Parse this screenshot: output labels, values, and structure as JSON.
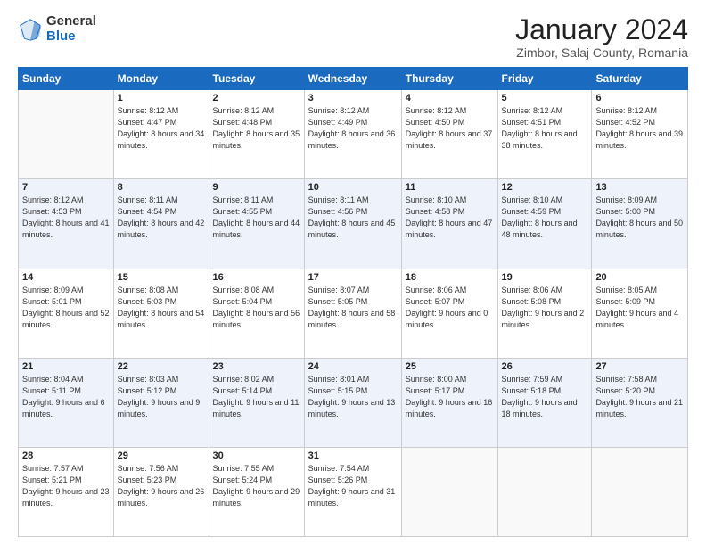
{
  "logo": {
    "general": "General",
    "blue": "Blue"
  },
  "title": "January 2024",
  "location": "Zimbor, Salaj County, Romania",
  "weekdays": [
    "Sunday",
    "Monday",
    "Tuesday",
    "Wednesday",
    "Thursday",
    "Friday",
    "Saturday"
  ],
  "weeks": [
    [
      {
        "day": "",
        "sunrise": "",
        "sunset": "",
        "daylight": ""
      },
      {
        "day": "1",
        "sunrise": "Sunrise: 8:12 AM",
        "sunset": "Sunset: 4:47 PM",
        "daylight": "Daylight: 8 hours and 34 minutes."
      },
      {
        "day": "2",
        "sunrise": "Sunrise: 8:12 AM",
        "sunset": "Sunset: 4:48 PM",
        "daylight": "Daylight: 8 hours and 35 minutes."
      },
      {
        "day": "3",
        "sunrise": "Sunrise: 8:12 AM",
        "sunset": "Sunset: 4:49 PM",
        "daylight": "Daylight: 8 hours and 36 minutes."
      },
      {
        "day": "4",
        "sunrise": "Sunrise: 8:12 AM",
        "sunset": "Sunset: 4:50 PM",
        "daylight": "Daylight: 8 hours and 37 minutes."
      },
      {
        "day": "5",
        "sunrise": "Sunrise: 8:12 AM",
        "sunset": "Sunset: 4:51 PM",
        "daylight": "Daylight: 8 hours and 38 minutes."
      },
      {
        "day": "6",
        "sunrise": "Sunrise: 8:12 AM",
        "sunset": "Sunset: 4:52 PM",
        "daylight": "Daylight: 8 hours and 39 minutes."
      }
    ],
    [
      {
        "day": "7",
        "sunrise": "Sunrise: 8:12 AM",
        "sunset": "Sunset: 4:53 PM",
        "daylight": "Daylight: 8 hours and 41 minutes."
      },
      {
        "day": "8",
        "sunrise": "Sunrise: 8:11 AM",
        "sunset": "Sunset: 4:54 PM",
        "daylight": "Daylight: 8 hours and 42 minutes."
      },
      {
        "day": "9",
        "sunrise": "Sunrise: 8:11 AM",
        "sunset": "Sunset: 4:55 PM",
        "daylight": "Daylight: 8 hours and 44 minutes."
      },
      {
        "day": "10",
        "sunrise": "Sunrise: 8:11 AM",
        "sunset": "Sunset: 4:56 PM",
        "daylight": "Daylight: 8 hours and 45 minutes."
      },
      {
        "day": "11",
        "sunrise": "Sunrise: 8:10 AM",
        "sunset": "Sunset: 4:58 PM",
        "daylight": "Daylight: 8 hours and 47 minutes."
      },
      {
        "day": "12",
        "sunrise": "Sunrise: 8:10 AM",
        "sunset": "Sunset: 4:59 PM",
        "daylight": "Daylight: 8 hours and 48 minutes."
      },
      {
        "day": "13",
        "sunrise": "Sunrise: 8:09 AM",
        "sunset": "Sunset: 5:00 PM",
        "daylight": "Daylight: 8 hours and 50 minutes."
      }
    ],
    [
      {
        "day": "14",
        "sunrise": "Sunrise: 8:09 AM",
        "sunset": "Sunset: 5:01 PM",
        "daylight": "Daylight: 8 hours and 52 minutes."
      },
      {
        "day": "15",
        "sunrise": "Sunrise: 8:08 AM",
        "sunset": "Sunset: 5:03 PM",
        "daylight": "Daylight: 8 hours and 54 minutes."
      },
      {
        "day": "16",
        "sunrise": "Sunrise: 8:08 AM",
        "sunset": "Sunset: 5:04 PM",
        "daylight": "Daylight: 8 hours and 56 minutes."
      },
      {
        "day": "17",
        "sunrise": "Sunrise: 8:07 AM",
        "sunset": "Sunset: 5:05 PM",
        "daylight": "Daylight: 8 hours and 58 minutes."
      },
      {
        "day": "18",
        "sunrise": "Sunrise: 8:06 AM",
        "sunset": "Sunset: 5:07 PM",
        "daylight": "Daylight: 9 hours and 0 minutes."
      },
      {
        "day": "19",
        "sunrise": "Sunrise: 8:06 AM",
        "sunset": "Sunset: 5:08 PM",
        "daylight": "Daylight: 9 hours and 2 minutes."
      },
      {
        "day": "20",
        "sunrise": "Sunrise: 8:05 AM",
        "sunset": "Sunset: 5:09 PM",
        "daylight": "Daylight: 9 hours and 4 minutes."
      }
    ],
    [
      {
        "day": "21",
        "sunrise": "Sunrise: 8:04 AM",
        "sunset": "Sunset: 5:11 PM",
        "daylight": "Daylight: 9 hours and 6 minutes."
      },
      {
        "day": "22",
        "sunrise": "Sunrise: 8:03 AM",
        "sunset": "Sunset: 5:12 PM",
        "daylight": "Daylight: 9 hours and 9 minutes."
      },
      {
        "day": "23",
        "sunrise": "Sunrise: 8:02 AM",
        "sunset": "Sunset: 5:14 PM",
        "daylight": "Daylight: 9 hours and 11 minutes."
      },
      {
        "day": "24",
        "sunrise": "Sunrise: 8:01 AM",
        "sunset": "Sunset: 5:15 PM",
        "daylight": "Daylight: 9 hours and 13 minutes."
      },
      {
        "day": "25",
        "sunrise": "Sunrise: 8:00 AM",
        "sunset": "Sunset: 5:17 PM",
        "daylight": "Daylight: 9 hours and 16 minutes."
      },
      {
        "day": "26",
        "sunrise": "Sunrise: 7:59 AM",
        "sunset": "Sunset: 5:18 PM",
        "daylight": "Daylight: 9 hours and 18 minutes."
      },
      {
        "day": "27",
        "sunrise": "Sunrise: 7:58 AM",
        "sunset": "Sunset: 5:20 PM",
        "daylight": "Daylight: 9 hours and 21 minutes."
      }
    ],
    [
      {
        "day": "28",
        "sunrise": "Sunrise: 7:57 AM",
        "sunset": "Sunset: 5:21 PM",
        "daylight": "Daylight: 9 hours and 23 minutes."
      },
      {
        "day": "29",
        "sunrise": "Sunrise: 7:56 AM",
        "sunset": "Sunset: 5:23 PM",
        "daylight": "Daylight: 9 hours and 26 minutes."
      },
      {
        "day": "30",
        "sunrise": "Sunrise: 7:55 AM",
        "sunset": "Sunset: 5:24 PM",
        "daylight": "Daylight: 9 hours and 29 minutes."
      },
      {
        "day": "31",
        "sunrise": "Sunrise: 7:54 AM",
        "sunset": "Sunset: 5:26 PM",
        "daylight": "Daylight: 9 hours and 31 minutes."
      },
      {
        "day": "",
        "sunrise": "",
        "sunset": "",
        "daylight": ""
      },
      {
        "day": "",
        "sunrise": "",
        "sunset": "",
        "daylight": ""
      },
      {
        "day": "",
        "sunrise": "",
        "sunset": "",
        "daylight": ""
      }
    ]
  ]
}
